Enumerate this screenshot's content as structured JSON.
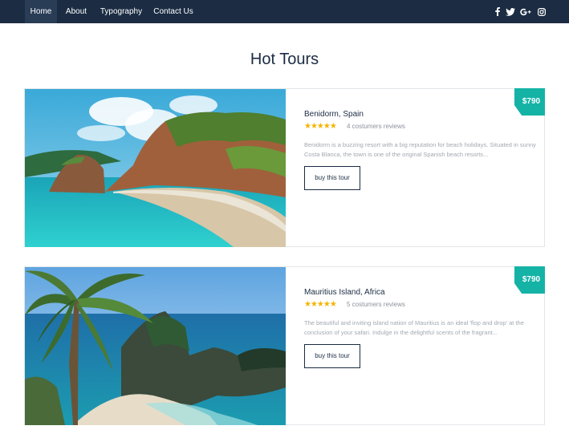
{
  "nav": {
    "items": [
      {
        "label": "Home"
      },
      {
        "label": "About"
      },
      {
        "label": "Typography"
      },
      {
        "label": "Contact Us"
      }
    ],
    "social_icons": [
      "facebook-icon",
      "twitter-icon",
      "google-plus-icon",
      "instagram-icon"
    ]
  },
  "main": {
    "heading": "Hot Tours"
  },
  "tours": [
    {
      "price": "$790",
      "title": "Benidorm, Spain",
      "rating": 4.5,
      "stars": "★★★★★",
      "reviews": "4 costumers reviews",
      "description": "Benidorm is a buzzing resort with a big reputation for beach holidays. Situated in sunny Costa Blanca, the town is one of the original Spanish beach resorts...",
      "button_label": "buy this tour"
    },
    {
      "price": "$790",
      "title": "Mauritius Island, Africa",
      "rating": 4.5,
      "stars": "★★★★★",
      "reviews": "5 costumers reviews",
      "description": "The beautiful and inviting island nation of Mauritius is an ideal 'flop and drop' at the conclusion of your safari. Indulge in the delightful scents of the fragrant...",
      "button_label": "buy this tour"
    }
  ],
  "colors": {
    "navbar": "#1b2c43",
    "accent": "#14b3a6",
    "stars": "#f4b400"
  }
}
